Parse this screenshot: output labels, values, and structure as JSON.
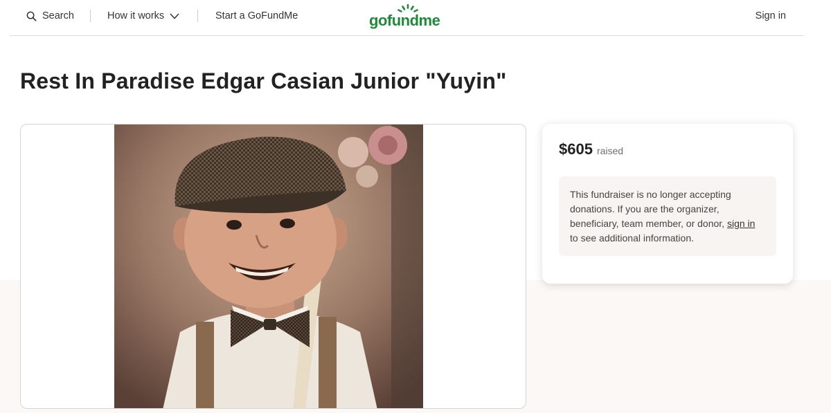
{
  "header": {
    "search_label": "Search",
    "how_label": "How it works",
    "start_label": "Start a GoFundMe",
    "logo_text": "gofundme",
    "signin_label": "Sign in",
    "icons": {
      "search": "search-icon",
      "how": "chevron-down-icon",
      "logo": "sun-logo-icon"
    },
    "brand_color": "#1f8b3a"
  },
  "title": "Rest In Paradise Edgar Casian Junior \"Yuyin\"",
  "media": {
    "photo": "boy-portrait"
  },
  "donation": {
    "amount": "$605",
    "raised_label": "raised",
    "notice_before": "This fundraiser is no longer accepting donations. If you are the organizer, beneficiary, team member, or donor, ",
    "notice_link": "sign in",
    "notice_after": " to see additional information."
  }
}
